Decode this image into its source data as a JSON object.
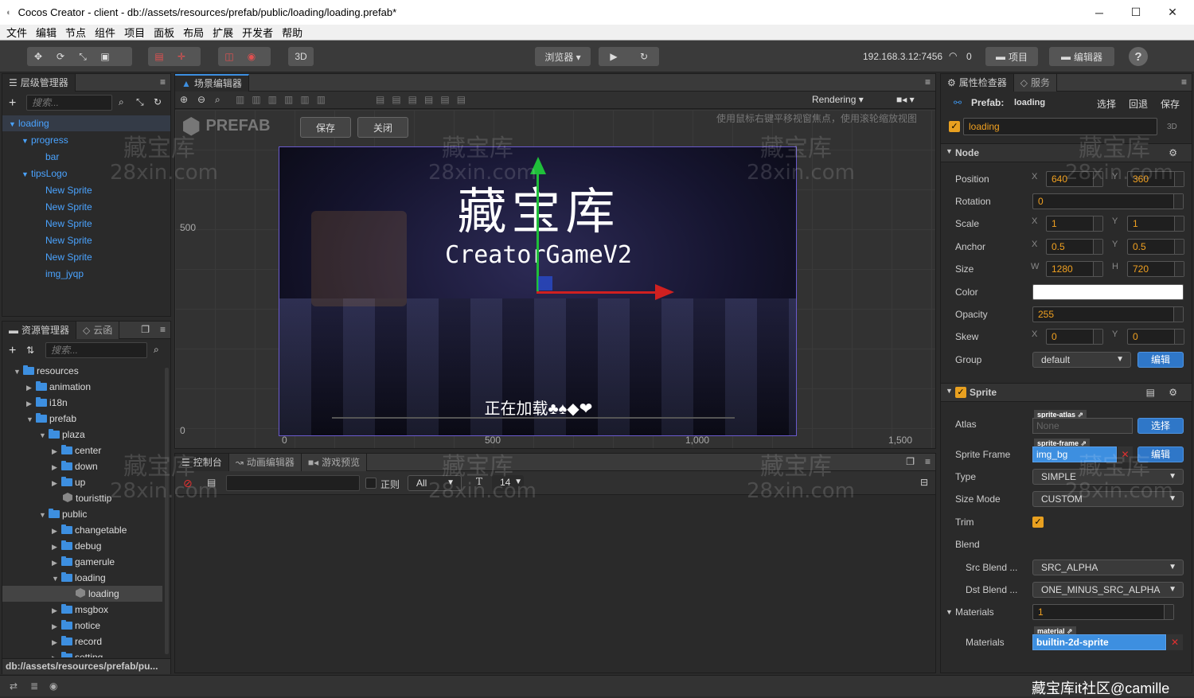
{
  "window": {
    "title": "Cocos Creator - client - db://assets/resources/prefab/public/loading/loading.prefab*",
    "minimize": "─",
    "maximize": "☐",
    "close": "✕"
  },
  "menu": [
    "文件",
    "编辑",
    "节点",
    "组件",
    "项目",
    "面板",
    "布局",
    "扩展",
    "开发者",
    "帮助"
  ],
  "toolbar": {
    "mode3d": "3D",
    "browser": "浏览器 ▾",
    "ip": "192.168.3.12:7456",
    "connections": "0",
    "project": "项目",
    "editor": "编辑器",
    "help": "?"
  },
  "hierarchy": {
    "tab": "层级管理器",
    "search_placeholder": "搜索...",
    "items": [
      {
        "label": "loading",
        "depth": 0,
        "expanded": true
      },
      {
        "label": "progress",
        "depth": 1,
        "expanded": true
      },
      {
        "label": "bar",
        "depth": 2
      },
      {
        "label": "tipsLogo",
        "depth": 1,
        "expanded": true
      },
      {
        "label": "New Sprite",
        "depth": 2
      },
      {
        "label": "New Sprite",
        "depth": 2
      },
      {
        "label": "New Sprite",
        "depth": 2
      },
      {
        "label": "New Sprite",
        "depth": 2
      },
      {
        "label": "New Sprite",
        "depth": 2
      },
      {
        "label": "img_jyqp",
        "depth": 2
      }
    ]
  },
  "assets": {
    "tab": "资源管理器",
    "tab2": "云函",
    "search_placeholder": "搜索...",
    "items": [
      {
        "label": "resources",
        "depth": 0,
        "type": "folder",
        "expanded": true
      },
      {
        "label": "animation",
        "depth": 1,
        "type": "folder"
      },
      {
        "label": "i18n",
        "depth": 1,
        "type": "folder"
      },
      {
        "label": "prefab",
        "depth": 1,
        "type": "folder",
        "expanded": true
      },
      {
        "label": "plaza",
        "depth": 2,
        "type": "folder",
        "expanded": true
      },
      {
        "label": "center",
        "depth": 3,
        "type": "folder"
      },
      {
        "label": "down",
        "depth": 3,
        "type": "folder"
      },
      {
        "label": "up",
        "depth": 3,
        "type": "folder"
      },
      {
        "label": "touristtip",
        "depth": 3,
        "type": "prefab"
      },
      {
        "label": "public",
        "depth": 2,
        "type": "folder",
        "expanded": true
      },
      {
        "label": "changetable",
        "depth": 3,
        "type": "folder"
      },
      {
        "label": "debug",
        "depth": 3,
        "type": "folder"
      },
      {
        "label": "gamerule",
        "depth": 3,
        "type": "folder"
      },
      {
        "label": "loading",
        "depth": 3,
        "type": "folder",
        "expanded": true
      },
      {
        "label": "loading",
        "depth": 4,
        "type": "prefab",
        "selected": true
      },
      {
        "label": "msgbox",
        "depth": 3,
        "type": "folder"
      },
      {
        "label": "notice",
        "depth": 3,
        "type": "folder"
      },
      {
        "label": "record",
        "depth": 3,
        "type": "folder"
      },
      {
        "label": "setting",
        "depth": 3,
        "type": "folder"
      }
    ],
    "footer_path": "db://assets/resources/prefab/pu..."
  },
  "scene": {
    "tab": "场景编辑器",
    "prefab_label": "PREFAB",
    "save": "保存",
    "close": "关闭",
    "rendering": "Rendering",
    "hint": "使用鼠标右键平移视窗焦点，使用滚轮缩放视图",
    "ruler_y": [
      "500",
      "0"
    ],
    "ruler_x": [
      "0",
      "500",
      "1,000",
      "1,500"
    ],
    "canvas_title": "藏宝库",
    "canvas_subtitle": "CreatorGameV2",
    "loading_text": "正在加载♣♠◆❤"
  },
  "console": {
    "tabs": [
      "控制台",
      "动画编辑器",
      "游戏预览"
    ],
    "regex": "正则",
    "filter": "All",
    "font_size": "14"
  },
  "inspector": {
    "tab": "属性检查器",
    "tab2": "服务",
    "prefab_label": "Prefab:",
    "prefab_name": "loading",
    "select": "选择",
    "revert": "回退",
    "save": "保存",
    "node_name": "loading",
    "badge3d": "3D",
    "node_section": "Node",
    "position": {
      "label": "Position",
      "x": "640",
      "y": "360"
    },
    "rotation": {
      "label": "Rotation",
      "value": "0"
    },
    "scale": {
      "label": "Scale",
      "x": "1",
      "y": "1"
    },
    "anchor": {
      "label": "Anchor",
      "x": "0.5",
      "y": "0.5"
    },
    "size": {
      "label": "Size",
      "w": "1280",
      "h": "720"
    },
    "color_label": "Color",
    "opacity": {
      "label": "Opacity",
      "value": "255"
    },
    "skew": {
      "label": "Skew",
      "x": "0",
      "y": "0"
    },
    "group": {
      "label": "Group",
      "value": "default",
      "edit": "编辑"
    },
    "sprite_section": "Sprite",
    "atlas": {
      "label": "Atlas",
      "tag": "sprite-atlas",
      "value": "None",
      "btn": "选择"
    },
    "sprite_frame": {
      "label": "Sprite Frame",
      "tag": "sprite-frame",
      "value": "img_bg",
      "btn": "编辑"
    },
    "type": {
      "label": "Type",
      "value": "SIMPLE"
    },
    "size_mode": {
      "label": "Size Mode",
      "value": "CUSTOM"
    },
    "trim_label": "Trim",
    "blend_label": "Blend",
    "src_blend": {
      "label": "Src Blend ...",
      "value": "SRC_ALPHA"
    },
    "dst_blend": {
      "label": "Dst Blend ...",
      "value": "ONE_MINUS_SRC_ALPHA"
    },
    "materials": {
      "label": "Materials",
      "count": "1"
    },
    "material": {
      "label": "Materials",
      "tag": "material",
      "value": "builtin-2d-sprite"
    }
  },
  "watermark": {
    "line1": "藏宝库",
    "line2": "28xin.com",
    "corner": "藏宝库it社区@camille"
  }
}
